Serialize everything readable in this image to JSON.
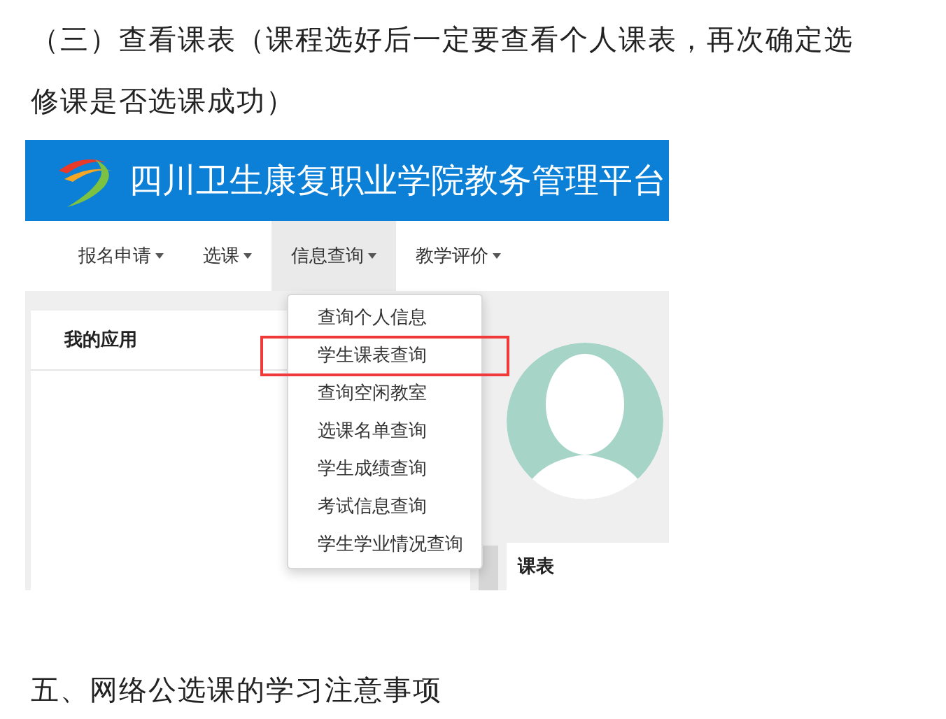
{
  "intro": "（三）查看课表（课程选好后一定要查看个人课表，再次确定选修课是否选课成功）",
  "screenshot": {
    "banner_title": "四川卫生康复职业学院教务管理平台",
    "nav": [
      {
        "label": "报名申请",
        "selected": false
      },
      {
        "label": "选课",
        "selected": false
      },
      {
        "label": "信息查询",
        "selected": true
      },
      {
        "label": "教学评价",
        "selected": false
      }
    ],
    "menu": [
      {
        "label": "查询个人信息",
        "highlighted": false
      },
      {
        "label": "学生课表查询",
        "highlighted": true
      },
      {
        "label": "查询空闲教室",
        "highlighted": false
      },
      {
        "label": "选课名单查询",
        "highlighted": false
      },
      {
        "label": "学生成绩查询",
        "highlighted": false
      },
      {
        "label": "考试信息查询",
        "highlighted": false
      },
      {
        "label": "学生学业情况查询",
        "highlighted": false
      }
    ],
    "apps_title": "我的应用",
    "schedule_title": "课表"
  },
  "heading": "五、网络公选课的学习注意事项"
}
